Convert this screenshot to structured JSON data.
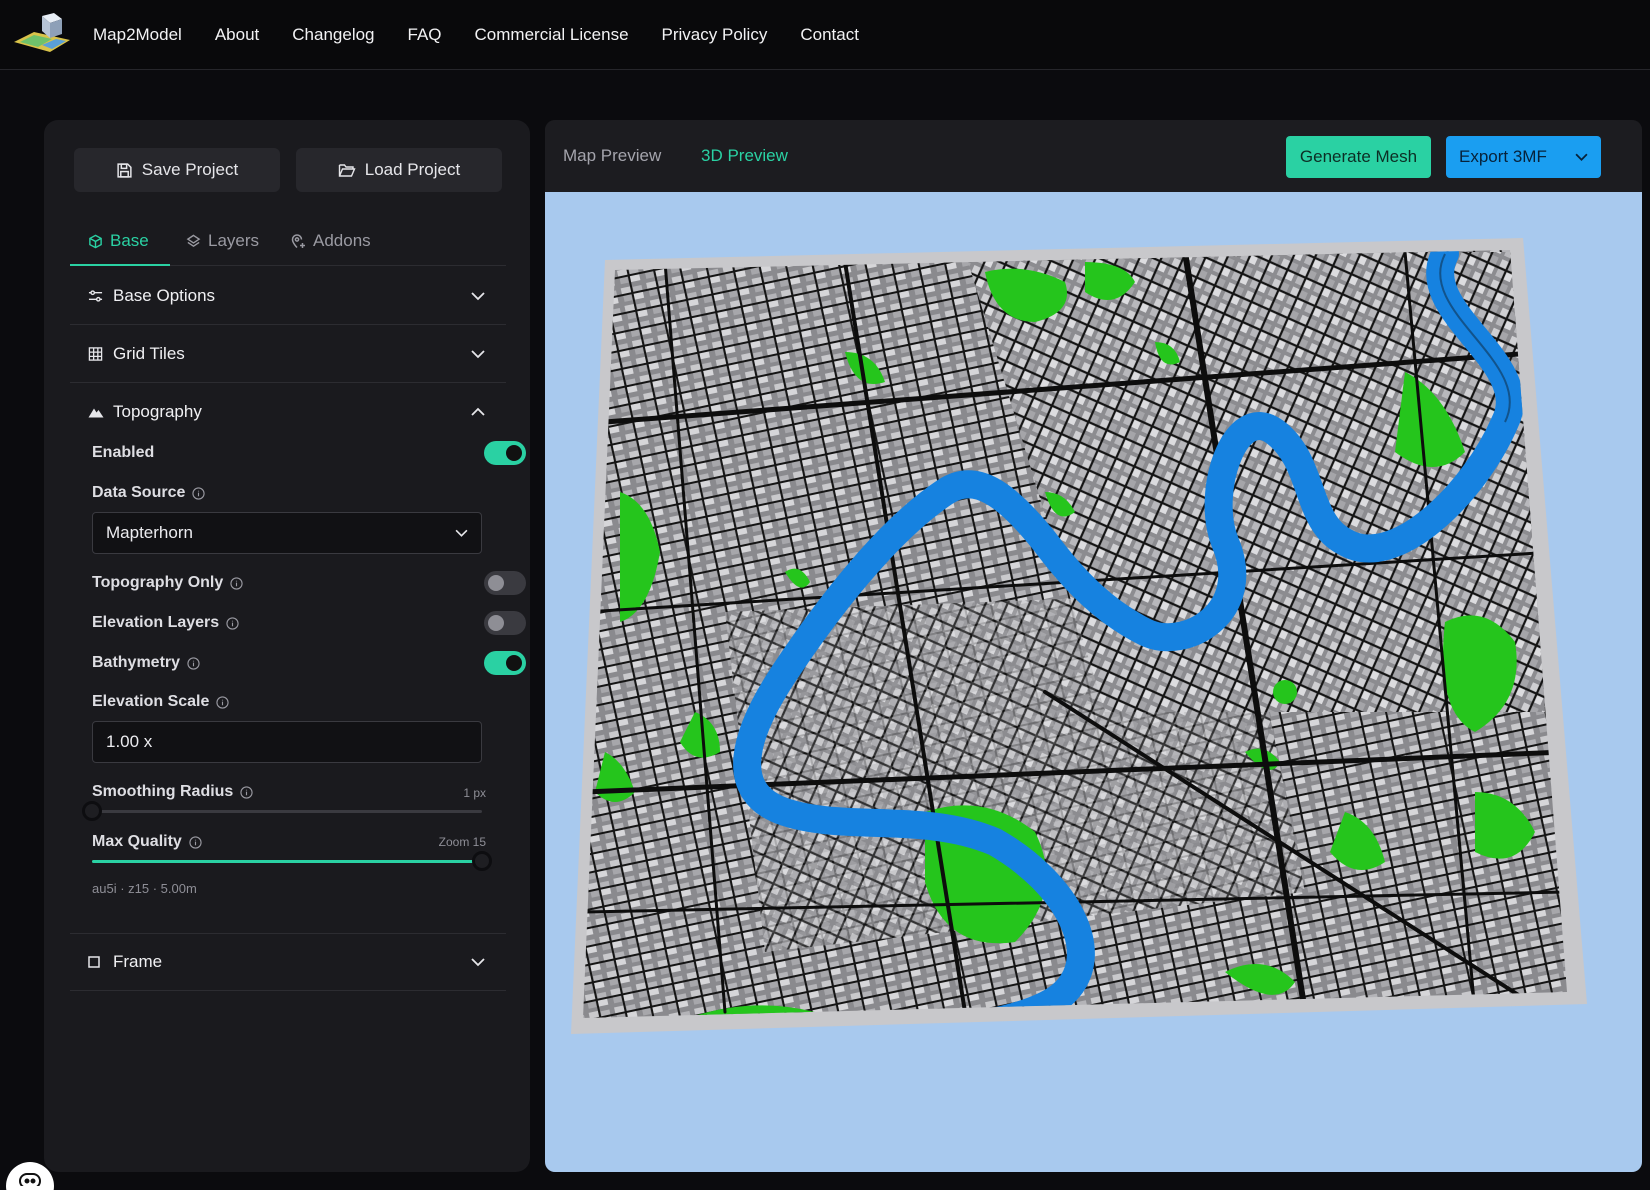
{
  "nav": {
    "brand": "Map2Model",
    "links": [
      "About",
      "Changelog",
      "FAQ",
      "Commercial License",
      "Privacy Policy",
      "Contact"
    ]
  },
  "project": {
    "save_label": "Save Project",
    "load_label": "Load Project"
  },
  "tabs": {
    "base": "Base",
    "layers": "Layers",
    "addons": "Addons",
    "active": "Base"
  },
  "sections": {
    "base_options": "Base Options",
    "grid_tiles": "Grid Tiles",
    "topography": "Topography",
    "frame": "Frame"
  },
  "topography": {
    "enabled_label": "Enabled",
    "enabled": true,
    "data_source_label": "Data Source",
    "data_source_value": "Mapterhorn",
    "topography_only_label": "Topography Only",
    "topography_only": false,
    "elevation_layers_label": "Elevation Layers",
    "elevation_layers": false,
    "bathymetry_label": "Bathymetry",
    "bathymetry": true,
    "elevation_scale_label": "Elevation Scale",
    "elevation_scale_value": "1.00 x",
    "smoothing_radius_label": "Smoothing Radius",
    "smoothing_radius_value": "1 px",
    "smoothing_radius_fraction": 0.0,
    "max_quality_label": "Max Quality",
    "max_quality_value": "Zoom 15",
    "max_quality_fraction": 1.0,
    "meta": "au5i · z15 · 5.00m"
  },
  "preview": {
    "map_preview_tab": "Map Preview",
    "preview_3d_tab": "3D Preview",
    "active": "3D Preview",
    "generate_label": "Generate Mesh",
    "export_label": "Export 3MF"
  },
  "colors": {
    "accent": "#2ad1a3",
    "export_blue": "#1a9ef1",
    "preview_bg": "#a8c9ee",
    "river": "#1682e0",
    "parks": "#25c51c"
  }
}
